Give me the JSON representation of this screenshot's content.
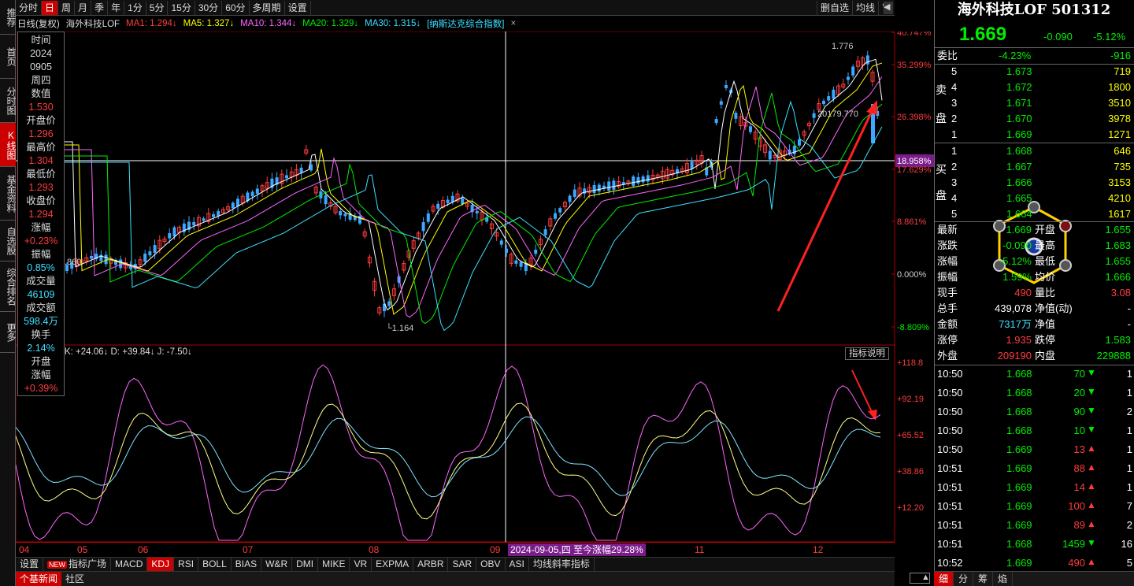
{
  "leftnav": [
    "推荐",
    "首页",
    "分时图",
    "K线图",
    "基金资料",
    "自选股",
    "综合排名",
    "更多"
  ],
  "leftnav_active": 3,
  "periods": [
    "分时",
    "日",
    "周",
    "月",
    "季",
    "年",
    "1分",
    "5分",
    "15分",
    "30分",
    "60分",
    "多周期",
    "设置"
  ],
  "period_active": 1,
  "top_right": [
    "删自选",
    "均线",
    "窗"
  ],
  "ma_legend": {
    "title": "日线(复权)",
    "name": "海外科技LOF",
    "ma1": "MA1: 1.294↓",
    "ma5": "MA5: 1.327↓",
    "ma10": "MA10: 1.344↓",
    "ma20": "MA20: 1.329↓",
    "ma30": "MA30: 1.315↓",
    "overlay": "[纳斯达克综合指数]"
  },
  "info_panel": [
    {
      "label": "时间",
      "value": "2024"
    },
    {
      "label": "",
      "value": "0905"
    },
    {
      "label": "周四",
      "value": ""
    },
    {
      "label": "数值",
      "value": "1.530"
    },
    {
      "label": "开盘价",
      "value": "1.296"
    },
    {
      "label": "最高价",
      "value": "1.304"
    },
    {
      "label": "最低价",
      "value": "1.293"
    },
    {
      "label": "收盘价",
      "value": "1.294"
    },
    {
      "label": "涨幅",
      "value": "+0.23%"
    },
    {
      "label": "振幅",
      "value": "0.85%"
    },
    {
      "label": "成交量",
      "value": "46109"
    },
    {
      "label": "成交额",
      "value": "598.4万"
    },
    {
      "label": "换手",
      "value": "2.14%"
    },
    {
      "label": "开盘",
      "value": ""
    },
    {
      "label": "涨幅",
      "value": "+0.39%"
    }
  ],
  "price_axis": [
    "40.747%",
    "35.299%",
    "26.398%",
    "18.958%",
    "17.629%",
    "8.861%",
    "0.000%",
    "-8.809%"
  ],
  "price_annotations": {
    "high": "1.776",
    "low": "1.164",
    "left": ".860",
    "overlay_value": "20179.770"
  },
  "kdj_legend": "K: +24.06↓  D: +39.84↓  J: -7.50↓",
  "indicator_help": "指标说明",
  "kdj_axis": [
    "+118.8",
    "+92.19",
    "+65.52",
    "+38.86",
    "+12.20"
  ],
  "months": [
    "04",
    "05",
    "06",
    "07",
    "08",
    "09",
    "11",
    "12"
  ],
  "range_label": "2024-09-05,四 至今涨幅29.28%",
  "tabs": [
    "设置",
    "指标广场",
    "MACD",
    "KDJ",
    "RSI",
    "BOLL",
    "BIAS",
    "W&R",
    "DMI",
    "MIKE",
    "VR",
    "EXPMA",
    "ARBR",
    "SAR",
    "OBV",
    "ASI",
    "均线斜率指标"
  ],
  "tab_new": "NEW",
  "tab_active": 3,
  "bottom_tabs": [
    "个基新闻",
    "社区"
  ],
  "quote": {
    "title": "海外科技LOF 501312",
    "price": "1.669",
    "change": "-0.090",
    "pct": "-5.12%",
    "weibi": {
      "label": "委比",
      "pct": "-4.23%",
      "diff": "-916"
    },
    "sell": [
      {
        "n": "5",
        "p": "1.673",
        "v": "719"
      },
      {
        "n": "4",
        "p": "1.672",
        "v": "1800"
      },
      {
        "n": "3",
        "p": "1.671",
        "v": "3510"
      },
      {
        "n": "2",
        "p": "1.670",
        "v": "3978"
      },
      {
        "n": "1",
        "p": "1.669",
        "v": "1271"
      }
    ],
    "buy": [
      {
        "n": "1",
        "p": "1.668",
        "v": "646"
      },
      {
        "n": "2",
        "p": "1.667",
        "v": "735"
      },
      {
        "n": "3",
        "p": "1.666",
        "v": "3153"
      },
      {
        "n": "4",
        "p": "1.665",
        "v": "4210"
      },
      {
        "n": "5",
        "p": "1.664",
        "v": "1617"
      }
    ],
    "sell_label": [
      "卖",
      "盘"
    ],
    "buy_label": [
      "买",
      "盘"
    ],
    "stats": [
      {
        "l1": "最新",
        "v1": "1.669",
        "l2": "开盘",
        "v2": "1.655"
      },
      {
        "l1": "涨跌",
        "v1": "-0.090",
        "l2": "最高",
        "v2": "1.683"
      },
      {
        "l1": "涨幅",
        "v1": "-5.12%",
        "l2": "最低",
        "v2": "1.655"
      },
      {
        "l1": "振幅",
        "v1": "1.59%",
        "l2": "均价",
        "v2": "1.666"
      },
      {
        "l1": "现手",
        "v1": "490",
        "l2": "量比",
        "v2": "3.08"
      },
      {
        "l1": "总手",
        "v1": "439,078",
        "l2": "净值(动)",
        "v2": "-"
      },
      {
        "l1": "金额",
        "v1": "7317万",
        "l2": "净值",
        "v2": "-"
      },
      {
        "l1": "涨停",
        "v1": "1.935",
        "l2": "跌停",
        "v2": "1.583"
      },
      {
        "l1": "外盘",
        "v1": "209190",
        "l2": "内盘",
        "v2": "229888"
      }
    ],
    "ticks": [
      {
        "t": "10:50",
        "p": "1.668",
        "v": "70",
        "d": "down",
        "n": "1"
      },
      {
        "t": "10:50",
        "p": "1.668",
        "v": "20",
        "d": "down",
        "n": "1"
      },
      {
        "t": "10:50",
        "p": "1.668",
        "v": "90",
        "d": "down",
        "n": "2"
      },
      {
        "t": "10:50",
        "p": "1.668",
        "v": "10",
        "d": "down",
        "n": "1"
      },
      {
        "t": "10:50",
        "p": "1.669",
        "v": "13",
        "d": "up",
        "n": "1"
      },
      {
        "t": "10:51",
        "p": "1.669",
        "v": "88",
        "d": "up",
        "n": "1"
      },
      {
        "t": "10:51",
        "p": "1.669",
        "v": "14",
        "d": "up",
        "n": "1"
      },
      {
        "t": "10:51",
        "p": "1.669",
        "v": "100",
        "d": "up",
        "n": "7"
      },
      {
        "t": "10:51",
        "p": "1.669",
        "v": "89",
        "d": "up",
        "n": "2"
      },
      {
        "t": "10:51",
        "p": "1.668",
        "v": "1459",
        "d": "down",
        "n": "16"
      },
      {
        "t": "10:52",
        "p": "1.669",
        "v": "490",
        "d": "up",
        "n": "5"
      }
    ],
    "bottom": [
      "细",
      "分",
      "筹",
      "焰"
    ]
  },
  "colors": {
    "up": "#ff3c3c",
    "down": "#00ee00",
    "cyan": "#3ce0ff",
    "ma5": "#ffffff",
    "ma10": "#ffff00",
    "ma20": "#ff66ff",
    "ma30": "#00ee00"
  }
}
